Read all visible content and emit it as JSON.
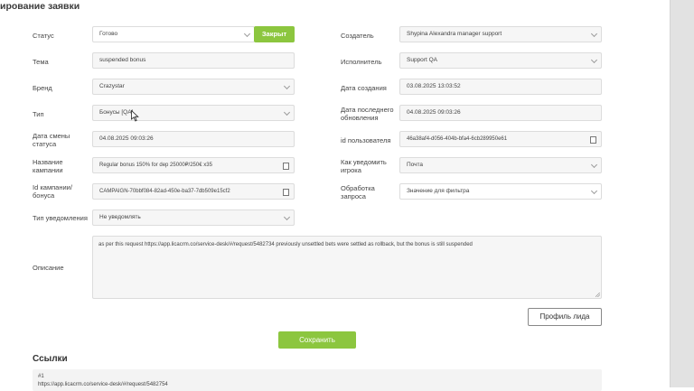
{
  "page": {
    "title": "ирование заявки"
  },
  "left": {
    "status": {
      "label": "Статус",
      "value": "Готово",
      "close_button": "Закрыт"
    },
    "subject": {
      "label": "Тема",
      "value": "suspended bonus"
    },
    "brand": {
      "label": "Бренд",
      "value": "Crazystar"
    },
    "type": {
      "label": "Тип",
      "value": "Бонусы [QA]"
    },
    "status_change_date": {
      "label": "Дата смены статуса",
      "value": "04.08.2025 09:03:26"
    },
    "campaign_name": {
      "label": "Название кампании",
      "value": "Regular bonus 150% for dep 25000₽/250€ x35"
    },
    "campaign_id": {
      "label": "Id кампании/ бонуса",
      "value": "CAMPAIGN-70bbf084-82ad-450e-ba37-7db509e15cf2"
    },
    "notification_type": {
      "label": "Тип уведомления",
      "value": "Не уведомлять"
    }
  },
  "right": {
    "creator": {
      "label": "Создатель",
      "value": "Shypina Alexandra manager support"
    },
    "assignee": {
      "label": "Исполнитель",
      "value": "Support QA"
    },
    "created_date": {
      "label": "Дата создания",
      "value": "03.08.2025 13:03:52"
    },
    "updated_date": {
      "label": "Дата последнего обновления",
      "value": "04.08.2025 09:03:26"
    },
    "user_id": {
      "label": "id пользователя",
      "value": "46a38af4-d056-404b-bfa4-6cb289950e61"
    },
    "notify_method": {
      "label": "Как уведомить игрока",
      "value": "Почта"
    },
    "processing": {
      "label": "Обработка запроса",
      "value": "Значение для фильтра"
    }
  },
  "description": {
    "label": "Описание",
    "value": "as per this request https://app.licacrm.co/service-desk/#/request/5482734 previously unsettled bets were settled as rollback, but the bonus is still suspended"
  },
  "buttons": {
    "profile": "Профиль лида",
    "save": "Сохранить"
  },
  "links": {
    "title": "Ссылки",
    "items": [
      {
        "num": "#1",
        "url": "https://app.licacrm.co/service-desk/#/request/5482754"
      }
    ]
  },
  "icons": {
    "chevron": "chevron-down-icon",
    "copy": "copy-icon",
    "cursor": "mouse-pointer-icon"
  },
  "colors": {
    "accent_green": "#8cc63f"
  }
}
